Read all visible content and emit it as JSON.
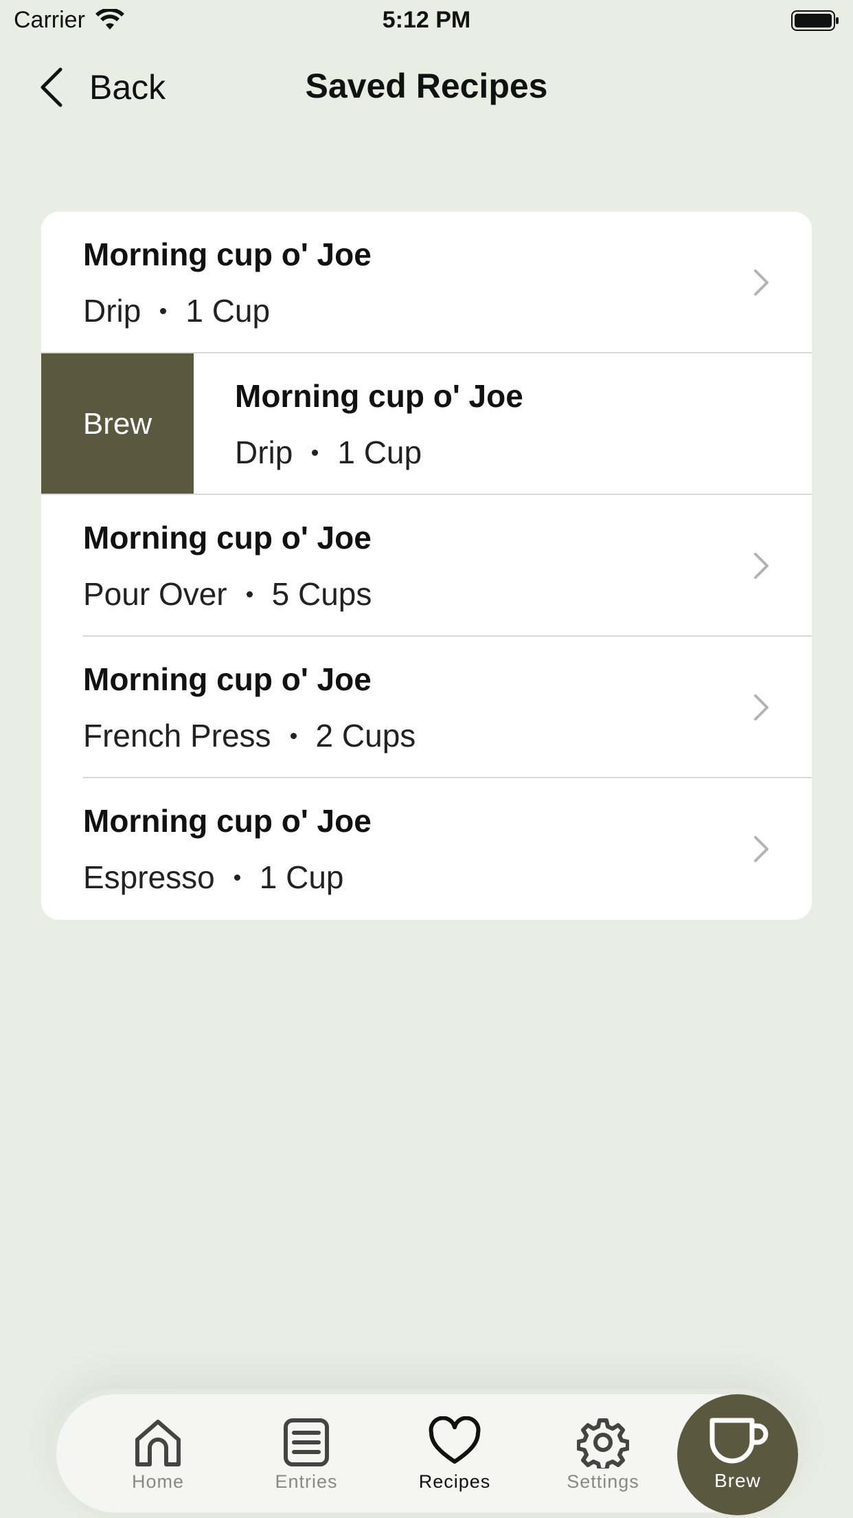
{
  "status_bar": {
    "carrier": "Carrier",
    "time": "5:12 PM"
  },
  "nav": {
    "back_label": "Back",
    "title": "Saved Recipes"
  },
  "recipes": [
    {
      "name": "Morning cup o' Joe",
      "method": "Drip",
      "amount": "1 Cup"
    },
    {
      "name": "Morning cup o' Joe",
      "method": "Drip",
      "amount": "1 Cup",
      "swipe_action": "Brew"
    },
    {
      "name": "Morning cup o' Joe",
      "method": "Pour Over",
      "amount": "5 Cups"
    },
    {
      "name": "Morning cup o' Joe",
      "method": "French Press",
      "amount": "2 Cups"
    },
    {
      "name": "Morning cup o' Joe",
      "method": "Espresso",
      "amount": "1 Cup"
    }
  ],
  "tab_bar": {
    "home": "Home",
    "entries": "Entries",
    "recipes": "Recipes",
    "settings": "Settings",
    "brew": "Brew",
    "active": "recipes"
  },
  "colors": {
    "background": "#e9ede4",
    "accent": "#5a583f",
    "card": "#ffffff",
    "inactive_tab": "#888888"
  }
}
